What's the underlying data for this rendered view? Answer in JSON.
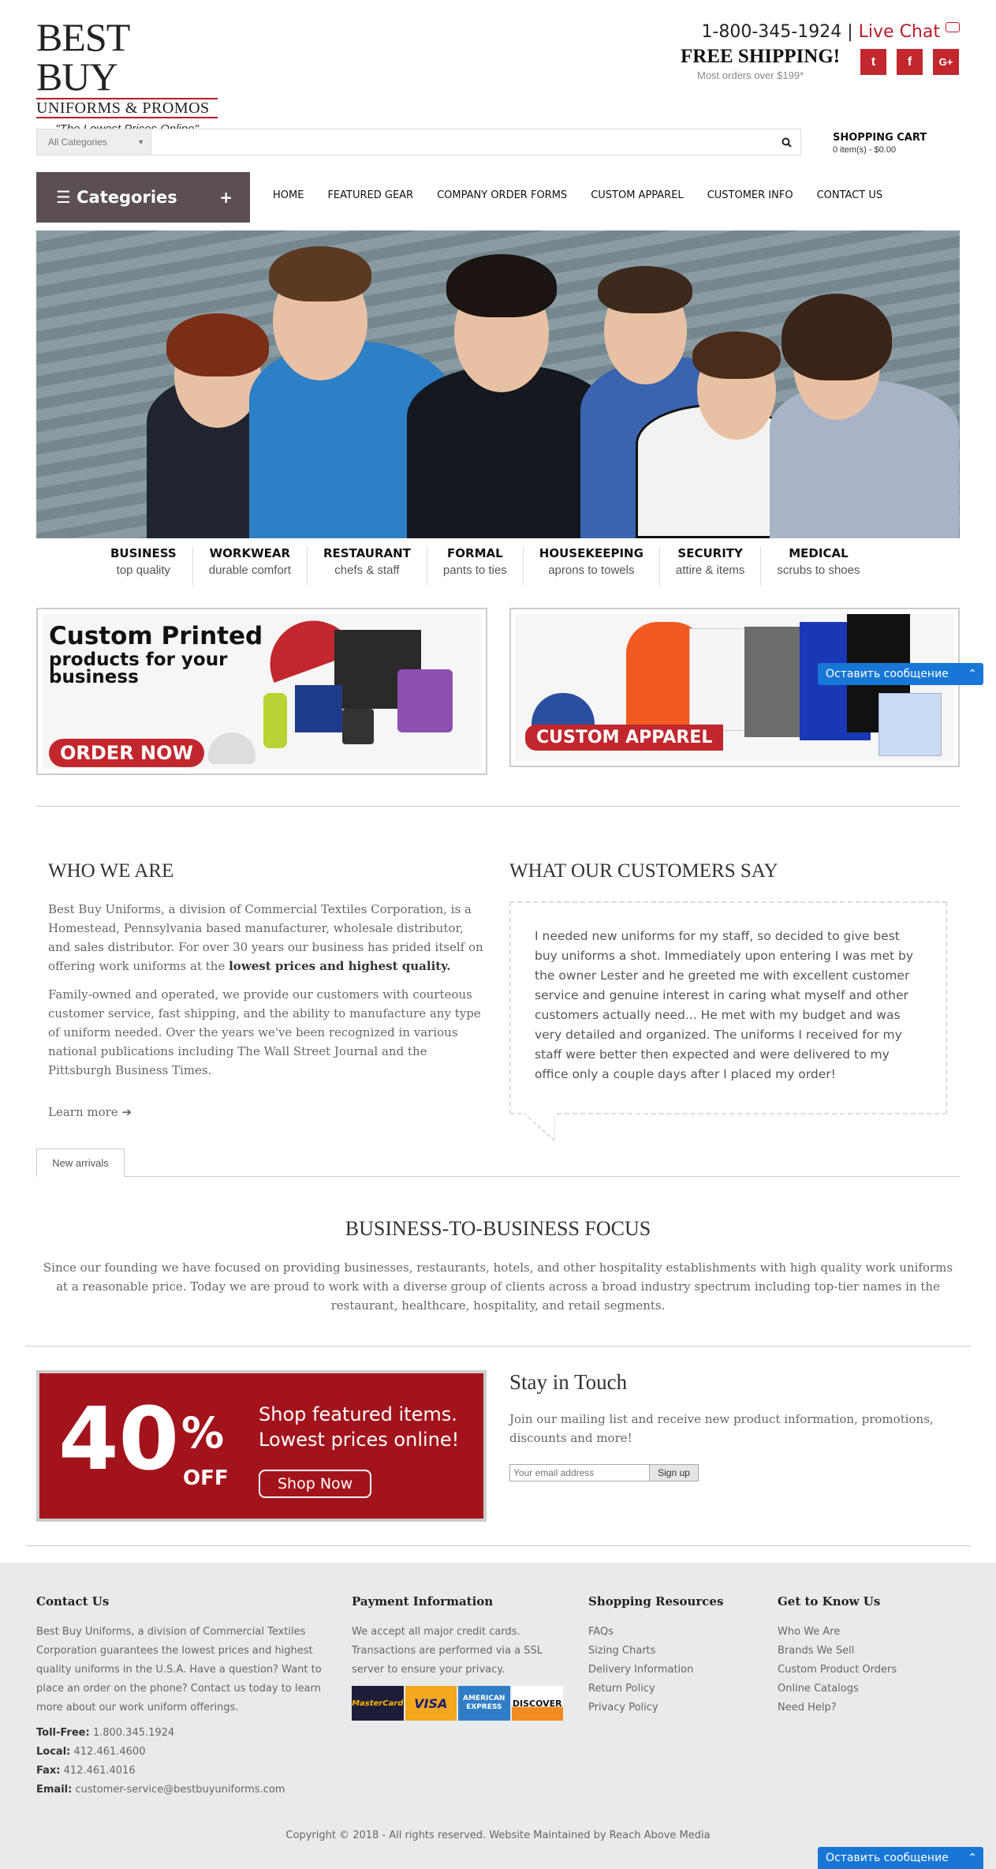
{
  "header": {
    "logo_main": "BEST BUY",
    "logo_sub": "UNIFORMS & PROMOS",
    "tagline": "\"The Lowest Prices Online\"",
    "phone": "1-800-345-1924",
    "separator": "|",
    "live_chat": "Live Chat",
    "free_shipping": "FREE SHIPPING!",
    "shipping_note": "Most orders over $199*",
    "social": [
      {
        "icon": "twitter-icon",
        "glyph": "t"
      },
      {
        "icon": "facebook-icon",
        "glyph": "f"
      },
      {
        "icon": "google-plus-icon",
        "glyph": "G+"
      }
    ]
  },
  "search": {
    "category_selected": "All Categories",
    "placeholder": "",
    "button_icon": "search-icon"
  },
  "cart": {
    "title": "SHOPPING CART",
    "count": "0 item(s) - $0.00"
  },
  "nav": {
    "categories_label": "Categories",
    "menu_icon": "☰",
    "plus": "+",
    "links": [
      "HOME",
      "FEATURED GEAR",
      "COMPANY ORDER FORMS",
      "CUSTOM APPAREL",
      "CUSTOMER INFO",
      "CONTACT US"
    ]
  },
  "category_strip": [
    {
      "title": "BUSINESS",
      "sub": "top quality"
    },
    {
      "title": "WORKWEAR",
      "sub": "durable comfort"
    },
    {
      "title": "RESTAURANT",
      "sub": "chefs & staff"
    },
    {
      "title": "FORMAL",
      "sub": "pants to ties"
    },
    {
      "title": "HOUSEKEEPING",
      "sub": "aprons to towels"
    },
    {
      "title": "SECURITY",
      "sub": "attire & items"
    },
    {
      "title": "MEDICAL",
      "sub": "scrubs to shoes"
    }
  ],
  "promos": {
    "left_title_1": "Custom Printed",
    "left_title_2": "products for your",
    "left_title_3": "business",
    "left_button": "ORDER NOW",
    "right_button": "CUSTOM APPAREL"
  },
  "who": {
    "title": "WHO WE ARE",
    "p1": "Best Buy Uniforms, a division of Commercial Textiles Corporation, is a Homestead, Pennsylvania based manufacturer, wholesale distributor, and sales distributor. For over 30 years our business has prided itself on offering work uniforms at the ",
    "p1_bold": "lowest prices and highest quality.",
    "p2": "Family-owned and operated, we provide our customers with courteous customer service, fast shipping, and the ability to manufacture any type of uniform needed. Over the years we've been recognized in various national publications including The Wall Street Journal and the Pittsburgh Business Times.",
    "learn_more": "Learn more ➔"
  },
  "testimonial": {
    "title": "WHAT OUR CUSTOMERS SAY",
    "quote": "I needed new uniforms for my staff, so decided to give best buy uniforms a shot. Immediately upon entering I was met by the owner Lester and he greeted me with excellent customer service and genuine interest in caring what myself and other customers actually need... He met with my budget and was very detailed and organized. The uniforms I received for my staff were better then expected and were delivered to my office only a couple days after I placed my order!"
  },
  "tabs": {
    "new_arrivals": "New arrivals"
  },
  "b2b": {
    "title": "BUSINESS-TO-BUSINESS FOCUS",
    "text": "Since our founding we have focused on providing businesses, restaurants, hotels, and other hospitality establishments with high quality work uniforms at a reasonable price. Today we are proud to work with a diverse group of clients across a broad industry spectrum including top-tier names in the restaurant, healthcare, hospitality, and retail segments."
  },
  "sale": {
    "big": "40",
    "pct": "%",
    "off": "OFF",
    "line1": "Shop featured items.",
    "line2": "Lowest prices online!",
    "button": "Shop Now"
  },
  "stay": {
    "title": "Stay in Touch",
    "text": "Join our mailing list and receive new product information, promotions, discounts and more!",
    "email_placeholder": "Your email address",
    "signup": "Sign up"
  },
  "footer": {
    "contact": {
      "title": "Contact Us",
      "text": "Best Buy Uniforms, a division of Commercial Textiles Corporation guarantees the lowest prices and highest quality uniforms in the U.S.A. Have a question? Want to place an order on the phone? Contact us today to learn more about our work uniform offerings.",
      "tollfree_label": "Toll-Free:",
      "tollfree": "1.800.345.1924",
      "local_label": "Local:",
      "local": "412.461.4600",
      "fax_label": "Fax:",
      "fax": "412.461.4016",
      "email_label": "Email:",
      "email": "customer-service@bestbuyuniforms.com"
    },
    "payment": {
      "title": "Payment Information",
      "text": "We accept all major credit cards. Transactions are performed via a SSL server to ensure your privacy.",
      "cards": [
        "MasterCard",
        "VISA",
        "AMERICAN EXPRESS",
        "DISCOVER"
      ]
    },
    "resources": {
      "title": "Shopping Resources",
      "items": [
        "FAQs",
        "Sizing Charts",
        "Delivery Information",
        "Return Policy",
        "Privacy Policy"
      ]
    },
    "know": {
      "title": "Get to Know Us",
      "items": [
        "Who We Are",
        "Brands We Sell",
        "Custom Product Orders",
        "Online Catalogs",
        "Need Help?"
      ]
    },
    "copyright": "Copyright © 2018 - All rights reserved. Website Maintained by Reach Above Media"
  },
  "livechat": {
    "label": "Оставить сообщение",
    "chevron": "⌃"
  },
  "colors": {
    "brand_red": "#c1272d",
    "nav_dark": "#5b4f55",
    "chat_blue": "#1877d6",
    "footer_bg": "#e9eaea"
  }
}
